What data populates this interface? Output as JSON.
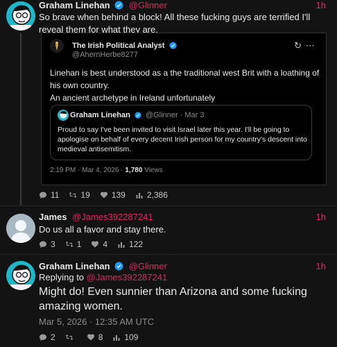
{
  "tweet1": {
    "name": "Graham Linehan",
    "handle": "@Glinner",
    "time": "1h",
    "text": "So brave when behind a block! All these fucking guys are terrified I'll reveal them for what they are.",
    "stats": {
      "replies": "11",
      "retweets": "19",
      "likes": "139",
      "views": "2,386"
    }
  },
  "quote": {
    "name": "The Irish Political Analyst",
    "handle": "@AhernHerbe8277",
    "text": "Linehan is best understood as a the traditional west Brit with a loathing of his own country.\nAn ancient archetype in Ireland unfortunately",
    "meta_time": "2:19 PM · Mar 4, 2026 · ",
    "meta_views": "1,780",
    "meta_views_label": " Views",
    "inner": {
      "name": "Graham Linehan",
      "handle": "@Glinner · Mar 3",
      "text": "Proud to say I've been invited to visit Israel later this year. I'll be going to apologise on behalf of every decent Irish person for my country's descent into medieval antisemitism."
    }
  },
  "tweet2": {
    "name": "James",
    "handle": "@James392287241",
    "time": "1h",
    "text": "Do us all a favor and stay there.",
    "stats": {
      "replies": "3",
      "retweets": "1",
      "likes": "4",
      "views": "122"
    }
  },
  "tweet3": {
    "name": "Graham Linehan",
    "handle": "@Glinner",
    "time": "1h",
    "replying_prefix": "Replying to ",
    "replying_to": "@James392287241",
    "text": "Might do! Even sunnier than Arizona and some fucking amazing women.",
    "timestamp": "Mar 5, 2026 · 12:35 AM UTC",
    "stats": {
      "replies": "2",
      "retweets": "",
      "likes": "8",
      "views": "109"
    }
  },
  "colors": {
    "accent": "#e0245e",
    "verified": "#1d9bf0",
    "background": "#131313"
  }
}
